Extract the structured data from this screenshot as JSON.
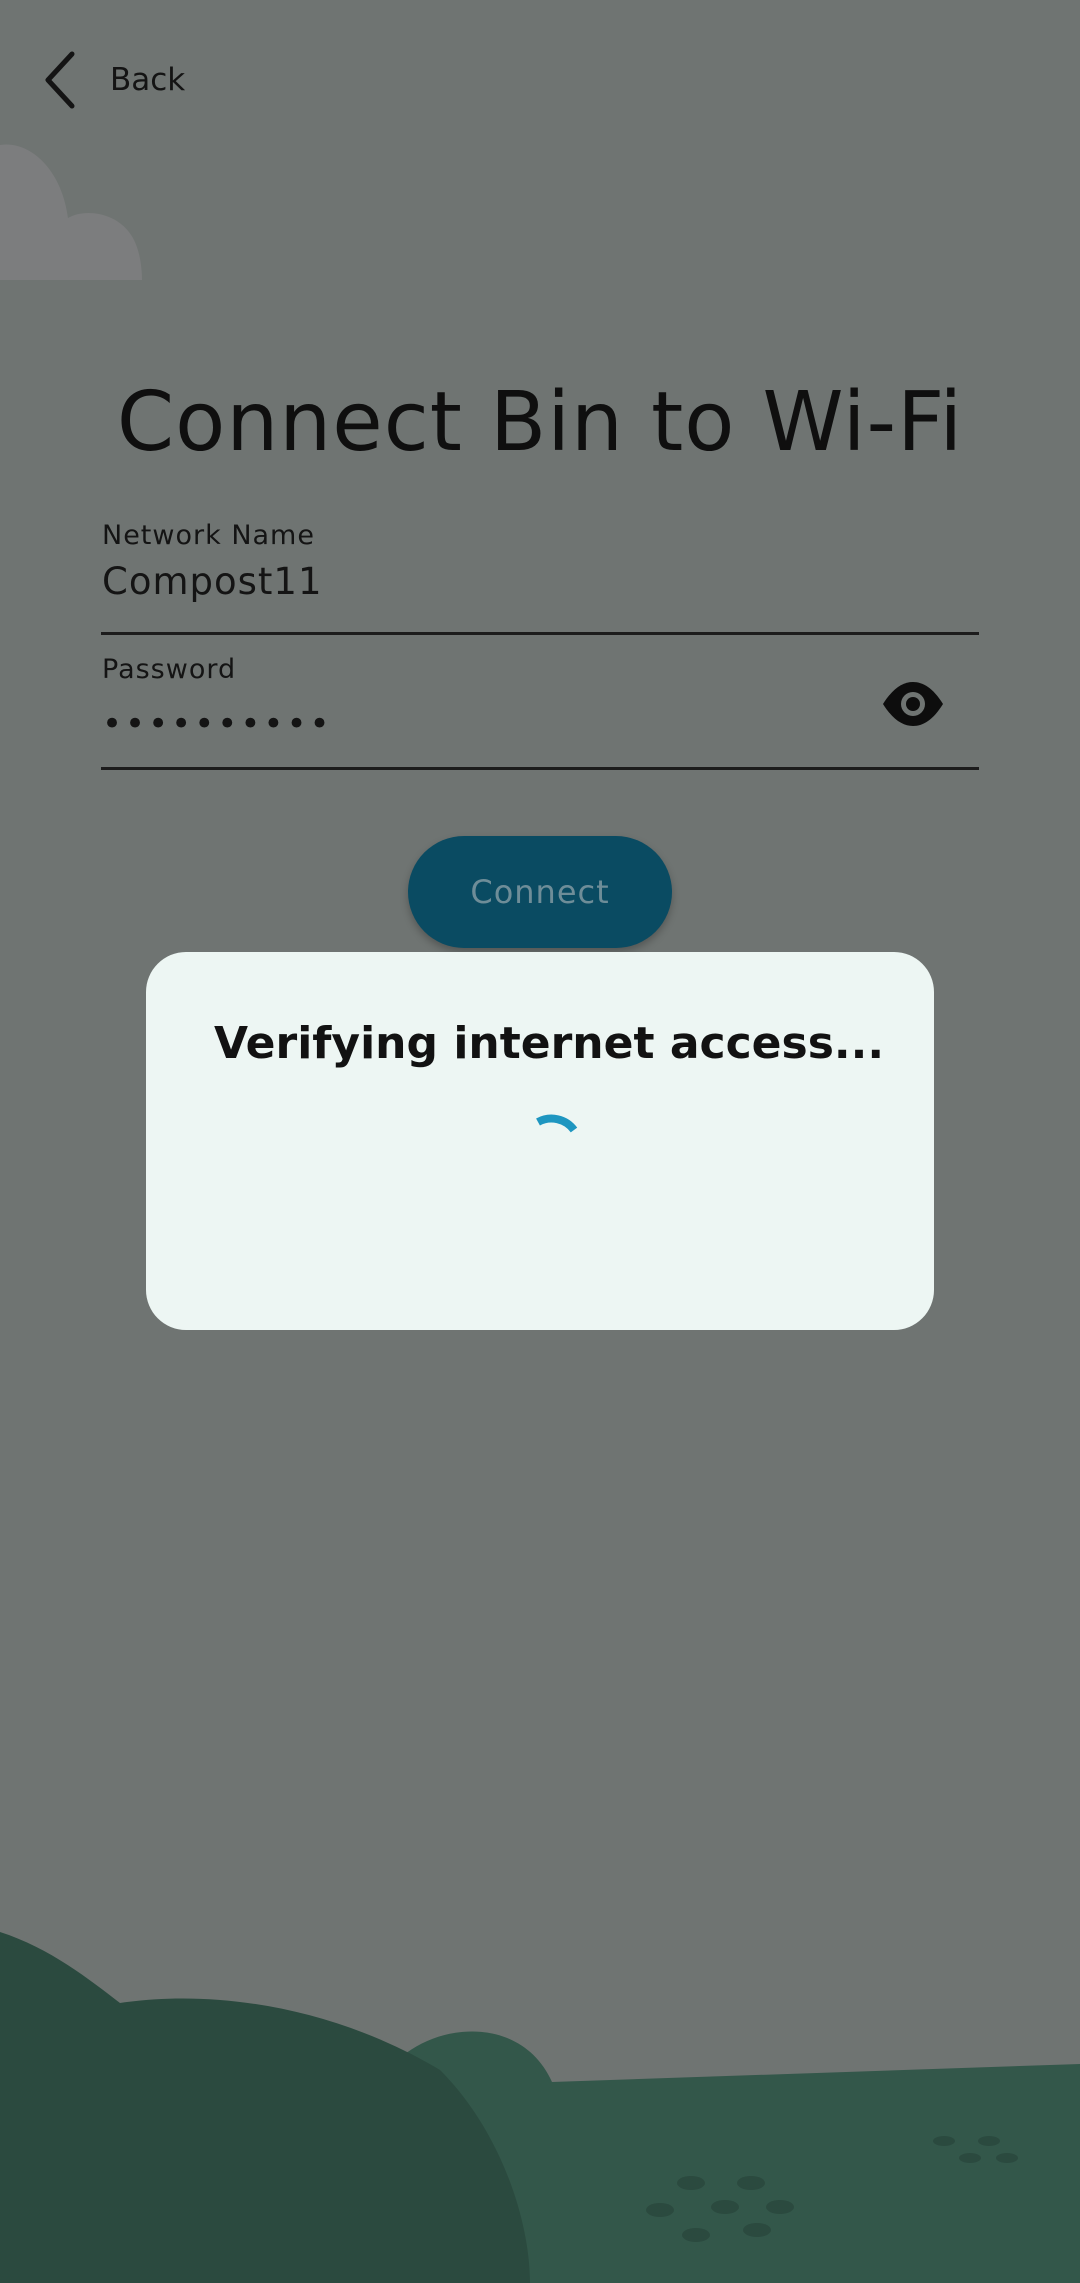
{
  "header": {
    "back_label": "Back"
  },
  "page": {
    "title": "Connect Bin to Wi-Fi"
  },
  "form": {
    "network_name": {
      "label": "Network Name",
      "value": "Compost11"
    },
    "password": {
      "label": "Password",
      "value_masked": "••••••••••"
    },
    "connect_label": "Connect"
  },
  "dialog": {
    "title": "Verifying internet access..."
  },
  "colors": {
    "background_dim": "#6f7472",
    "button": "#0a4b62",
    "dialog_bg": "#edf6f3",
    "spinner": "#1e96c0",
    "hill_dark": "#2b4a3f",
    "hill_light": "#33574a"
  },
  "icons": [
    "chevron-left-icon",
    "eye-icon",
    "loading-spinner-icon"
  ]
}
